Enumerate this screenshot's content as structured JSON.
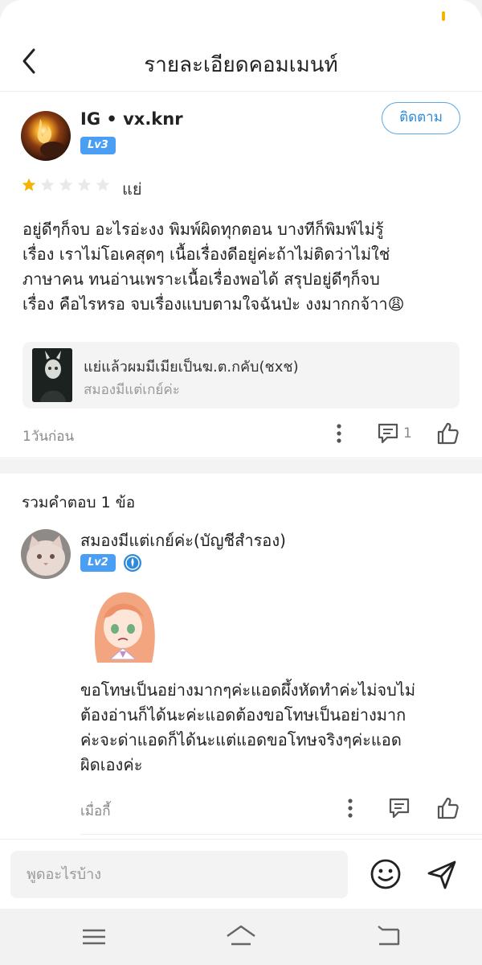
{
  "header": {
    "title": "รายละเอียดคอมเมนท์"
  },
  "review": {
    "username": "IG • vx.knr",
    "level": "Lv3",
    "follow_label": "ติดตาม",
    "rating": 1,
    "rating_max": 5,
    "rating_label": "แย่",
    "lines": [
      "อยู่ดีๆก็จบ อะไรอ่ะงง พิมพ์ผิดทุกตอน บางทีก็พิมพ์ไม่รู้",
      "เรื่อง เราไม่โอเคสุดๆ เนื้อเรื่องดีอยู่ค่ะถ้าไม่ติดว่าไม่ใช่",
      "ภาษาคน ทนอ่านเพราะเนื้อเรื่องพอได้ สรุปอยู่ดีๆก็จบ",
      "เรื่อง คือไรหรอ จบเรื่องแบบตามใจฉันป่ะ งงมากกจ้าา😩"
    ],
    "book": {
      "title": "แย่แล้วผมมีเมียเป็นฆ.ต.กคับ(ชxช)",
      "author": "สมองมีแต่เกย์ค่ะ"
    },
    "time": "1วันก่อน",
    "comment_count": "1"
  },
  "replies": {
    "title": "รวมคำตอบ 1 ข้อ",
    "items": [
      {
        "username": "สมองมีแต่เกย์ค่ะ(บัญชีสำรอง)",
        "level": "Lv2",
        "lines": [
          "ขอโทษเป็นอย่างมากๆค่ะแอดผึ้งหัดทำค่ะไม่จบไม่",
          "ต้องอ่านก็ได้นะค่ะแอดต้องขอโทษเป็นอย่างมาก",
          "ค่ะจะด่าแอดก็ได้นะแต่แอดขอโทษจริงๆค่ะแอด",
          "ผิดเองค่ะ"
        ],
        "time": "เมื่อกี้"
      }
    ]
  },
  "input": {
    "placeholder": "พูดอะไรบ้าง"
  },
  "colors": {
    "accent": "#4a9ff5",
    "follow": "#2f8ad8",
    "star": "#f5b400",
    "star_empty": "#e9e9e9"
  },
  "icons": {
    "back": "chevron-left-icon",
    "more": "more-vertical-icon",
    "comment": "comment-icon",
    "like": "thumbs-up-icon",
    "emoji": "smile-icon",
    "send": "send-icon",
    "verified": "verified-badge-icon",
    "nav_menu": "menu-icon",
    "nav_home": "home-icon",
    "nav_back": "back-icon"
  }
}
